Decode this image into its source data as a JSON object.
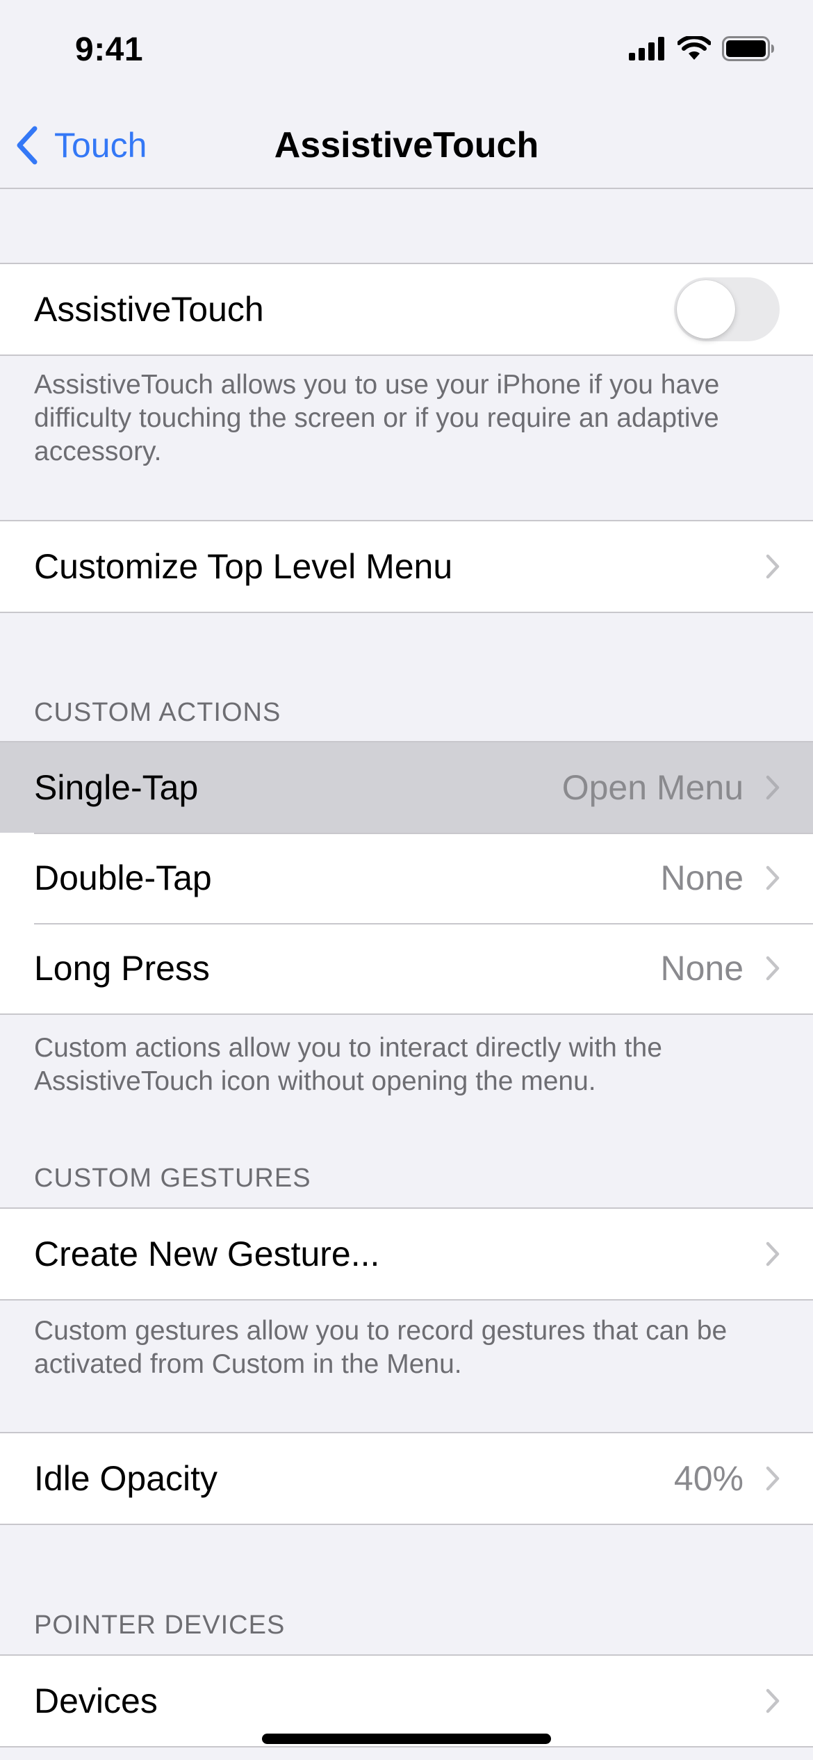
{
  "status_bar": {
    "time": "9:41"
  },
  "nav": {
    "back_label": "Touch",
    "title": "AssistiveTouch"
  },
  "main_toggle": {
    "label": "AssistiveTouch",
    "enabled": false,
    "footer": "AssistiveTouch allows you to use your iPhone if you have difficulty touching the screen or if you require an adaptive accessory."
  },
  "menu_group": {
    "customize_label": "Customize Top Level Menu"
  },
  "custom_actions": {
    "header": "CUSTOM ACTIONS",
    "items": [
      {
        "label": "Single-Tap",
        "value": "Open Menu"
      },
      {
        "label": "Double-Tap",
        "value": "None"
      },
      {
        "label": "Long Press",
        "value": "None"
      }
    ],
    "footer": "Custom actions allow you to interact directly with the AssistiveTouch icon without opening the menu."
  },
  "custom_gestures": {
    "header": "CUSTOM GESTURES",
    "create_label": "Create New Gesture...",
    "footer": "Custom gestures allow you to record gestures that can be activated from Custom in the Menu."
  },
  "idle_opacity": {
    "label": "Idle Opacity",
    "value": "40%"
  },
  "pointer_devices": {
    "header": "POINTER DEVICES",
    "devices_label": "Devices"
  },
  "colors": {
    "accent": "#3478f6",
    "background": "#f2f2f7",
    "highlight": "#d1d1d6",
    "secondary_text": "#8a8a8e"
  },
  "icons": {
    "back": "chevron-left-icon",
    "disclosure": "chevron-right-icon",
    "signal": "cellular-signal-icon",
    "wifi": "wifi-icon",
    "battery": "battery-icon"
  }
}
